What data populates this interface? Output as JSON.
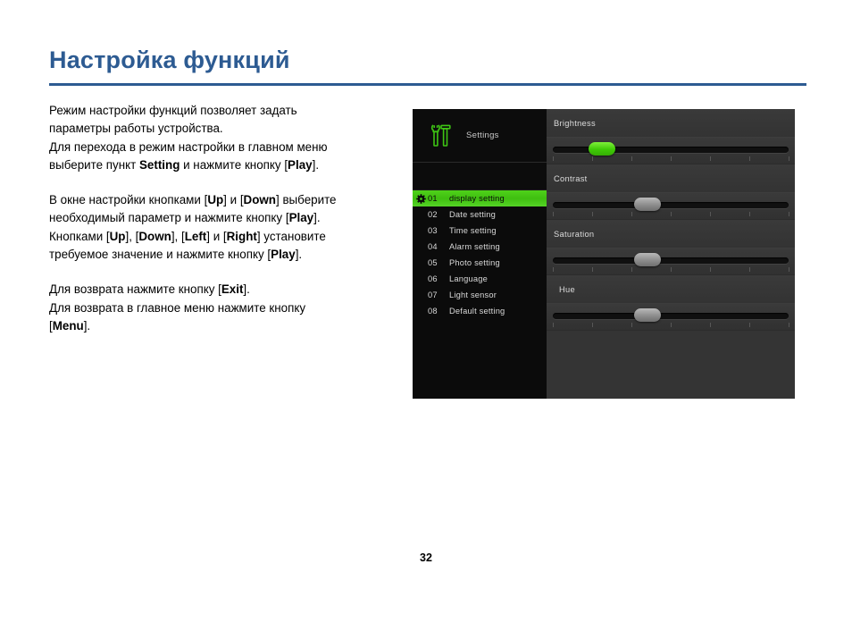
{
  "page": {
    "title": "Настройка функций",
    "number": "32",
    "accent_color": "#2d5b92"
  },
  "instructions": [
    {
      "id": "para-1",
      "lines": [
        [
          {
            "t": "Режим настройки функций позволяет задать"
          }
        ],
        [
          {
            "t": "параметры работы устройства."
          }
        ],
        [
          {
            "t": "Для перехода в режим настройки в главном меню"
          }
        ],
        [
          {
            "t": "выберите пункт "
          },
          {
            "t": "Setting",
            "b": true
          },
          {
            "t": " и нажмите кнопку ["
          },
          {
            "t": "Play",
            "b": true
          },
          {
            "t": "]."
          }
        ]
      ]
    },
    {
      "id": "para-2",
      "lines": [
        [
          {
            "t": "В окне настройки кнопками ["
          },
          {
            "t": "Up",
            "b": true
          },
          {
            "t": "] и ["
          },
          {
            "t": "Down",
            "b": true
          },
          {
            "t": "] выберите"
          }
        ],
        [
          {
            "t": "необходимый параметр и нажмите кнопку ["
          },
          {
            "t": "Play",
            "b": true
          },
          {
            "t": "]."
          }
        ],
        [
          {
            "t": "Кнопками ["
          },
          {
            "t": "Up",
            "b": true
          },
          {
            "t": "], ["
          },
          {
            "t": "Down",
            "b": true
          },
          {
            "t": "], ["
          },
          {
            "t": "Left",
            "b": true
          },
          {
            "t": "] и ["
          },
          {
            "t": "Right",
            "b": true
          },
          {
            "t": "] установите"
          }
        ],
        [
          {
            "t": "требуемое значение и нажмите кнопку ["
          },
          {
            "t": "Play",
            "b": true
          },
          {
            "t": "]."
          }
        ]
      ]
    },
    {
      "id": "para-3",
      "lines": [
        [
          {
            "t": "Для возврата нажмите кнопку ["
          },
          {
            "t": "Exit",
            "b": true
          },
          {
            "t": "]."
          }
        ],
        [
          {
            "t": "Для возврата в главное меню нажмите кнопку"
          }
        ],
        [
          {
            "t": "["
          },
          {
            "t": "Menu",
            "b": true
          },
          {
            "t": "]."
          }
        ]
      ]
    }
  ],
  "device": {
    "sidebar": {
      "header": {
        "icon": "tools-wrench-hammer-icon",
        "label": "Settings"
      },
      "selected_index": 0,
      "selected_icon": "gear-icon",
      "highlight_color": "#45c714",
      "items": [
        {
          "num": "01",
          "label": "display setting",
          "selected": true
        },
        {
          "num": "02",
          "label": "Date setting",
          "selected": false
        },
        {
          "num": "03",
          "label": "Time setting",
          "selected": false
        },
        {
          "num": "04",
          "label": "Alarm setting",
          "selected": false
        },
        {
          "num": "05",
          "label": "Photo setting",
          "selected": false
        },
        {
          "num": "06",
          "label": "Language",
          "selected": false
        },
        {
          "num": "07",
          "label": "Light sensor",
          "selected": false
        },
        {
          "num": "08",
          "label": "Default setting",
          "selected": false
        }
      ]
    },
    "sliders": [
      {
        "label": "Brightness",
        "value_pct": 21,
        "thumb": "green",
        "ticks": 7,
        "indent": false
      },
      {
        "label": "Contrast",
        "value_pct": 40,
        "thumb": "grey",
        "ticks": 7,
        "indent": false
      },
      {
        "label": "Saturation",
        "value_pct": 40,
        "thumb": "grey",
        "ticks": 7,
        "indent": false
      },
      {
        "label": "Hue",
        "value_pct": 40,
        "thumb": "grey",
        "ticks": 7,
        "indent": true
      }
    ]
  }
}
